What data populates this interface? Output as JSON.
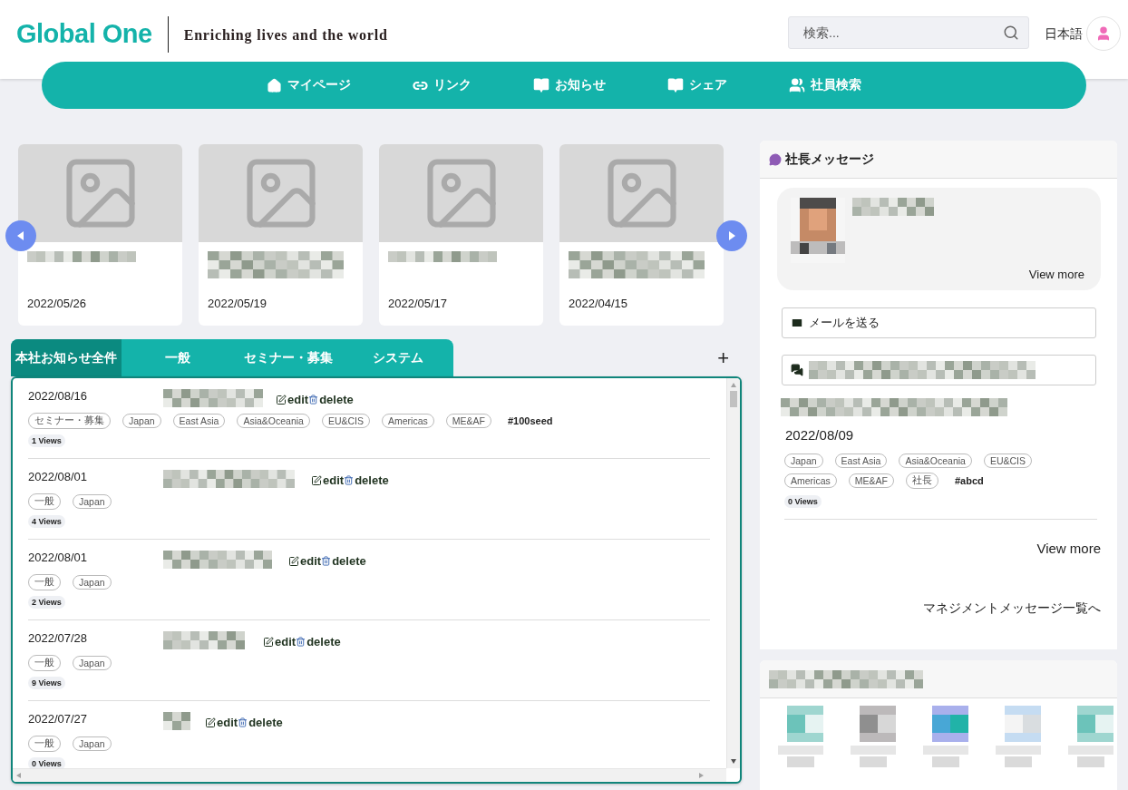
{
  "header": {
    "logo": "Global One",
    "tagline": "Enriching lives and the world",
    "search": {
      "placeholder": "検索..."
    },
    "language": "日本語"
  },
  "nav": [
    {
      "label": "マイページ"
    },
    {
      "label": "リンク"
    },
    {
      "label": "お知らせ"
    },
    {
      "label": "シェア"
    },
    {
      "label": "社員検索"
    }
  ],
  "carousel": {
    "cards": [
      {
        "date": "2022/05/26"
      },
      {
        "date": "2022/05/19"
      },
      {
        "date": "2022/05/17"
      },
      {
        "date": "2022/04/15"
      }
    ]
  },
  "notices": {
    "tabs": [
      {
        "label": "本社お知らせ全件",
        "selected": true
      },
      {
        "label": "一般",
        "selected": false
      },
      {
        "label": "セミナー・募集",
        "selected": false
      },
      {
        "label": "システム",
        "selected": false
      }
    ],
    "add_button": "+",
    "rows": [
      {
        "date": "2022/08/16",
        "edit": "edit",
        "delete": "delete",
        "tags": [
          "セミナー・募集",
          "Japan",
          "East Asia",
          "Asia&Oceania",
          "EU&CIS",
          "Americas",
          "ME&AF"
        ],
        "hashtag": "#100seed",
        "views": "1 Views"
      },
      {
        "date": "2022/08/01",
        "edit": "edit",
        "delete": "delete",
        "tags": [
          "一般",
          "Japan"
        ],
        "views": "4 Views"
      },
      {
        "date": "2022/08/01",
        "edit": "edit",
        "delete": "delete",
        "tags": [
          "一般",
          "Japan"
        ],
        "views": "2 Views"
      },
      {
        "date": "2022/07/28",
        "edit": "edit",
        "delete": "delete",
        "tags": [
          "一般",
          "Japan"
        ],
        "views": "9 Views"
      },
      {
        "date": "2022/07/27",
        "edit": "edit",
        "delete": "delete",
        "tags": [
          "一般",
          "Japan"
        ],
        "views": "0 Views"
      }
    ]
  },
  "president": {
    "title": "社長メッセージ",
    "view_more": "View more",
    "mail_button": "メールを送る",
    "date": "2022/08/09",
    "tags": [
      "Japan",
      "East Asia",
      "Asia&Oceania",
      "EU&CIS",
      "Americas",
      "ME&AF",
      "社長"
    ],
    "hashtag": "#abcd",
    "views": "0 Views",
    "view_more_link": "View more",
    "list_link": "マネジメントメッセージ一覧へ"
  }
}
